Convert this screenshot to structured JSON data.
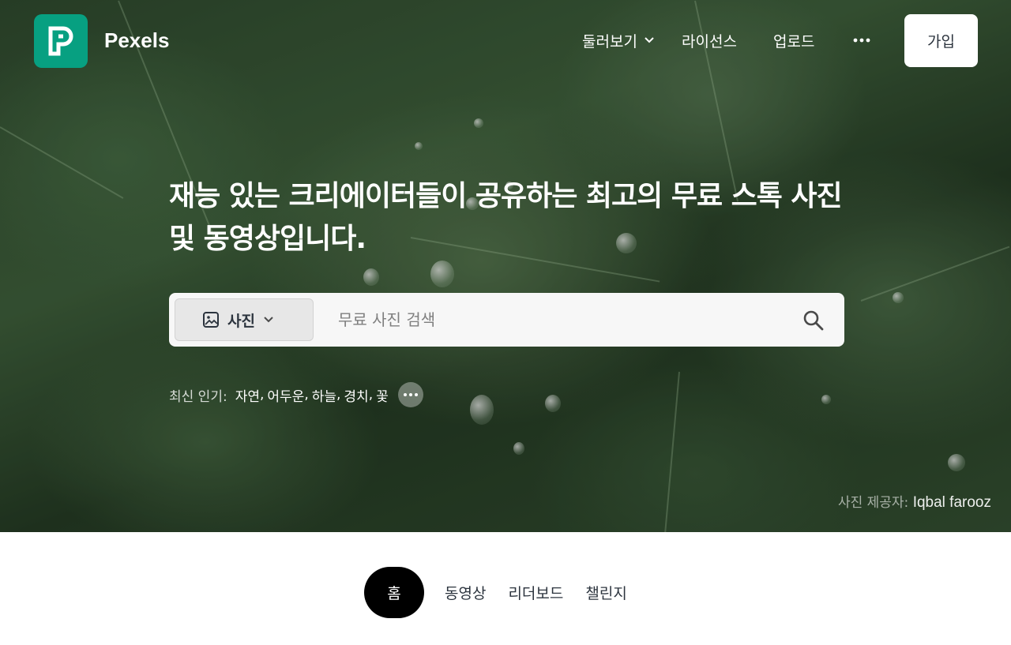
{
  "brand": {
    "name": "Pexels",
    "accent": "#07a081"
  },
  "nav": {
    "explore": "둘러보기",
    "license": "라이선스",
    "upload": "업로드",
    "more_icon": "more-horizontal-icon",
    "join": "가입"
  },
  "hero": {
    "headline": "재능 있는 크리에이터들이 공유하는 최고의 무료 스톡 사진 및 동영상입니다.",
    "search": {
      "type_label": "사진",
      "placeholder": "무료 사진 검색",
      "value": ""
    },
    "trending": {
      "label": "최신 인기:",
      "tags": [
        "자연",
        "어두운",
        "하늘",
        "경치",
        "꽃"
      ]
    },
    "credit": {
      "label": "사진 제공자:",
      "name": "Iqbal farooz"
    }
  },
  "tabs": [
    {
      "label": "홈",
      "active": true
    },
    {
      "label": "동영상",
      "active": false
    },
    {
      "label": "리더보드",
      "active": false
    },
    {
      "label": "챌린지",
      "active": false
    }
  ]
}
